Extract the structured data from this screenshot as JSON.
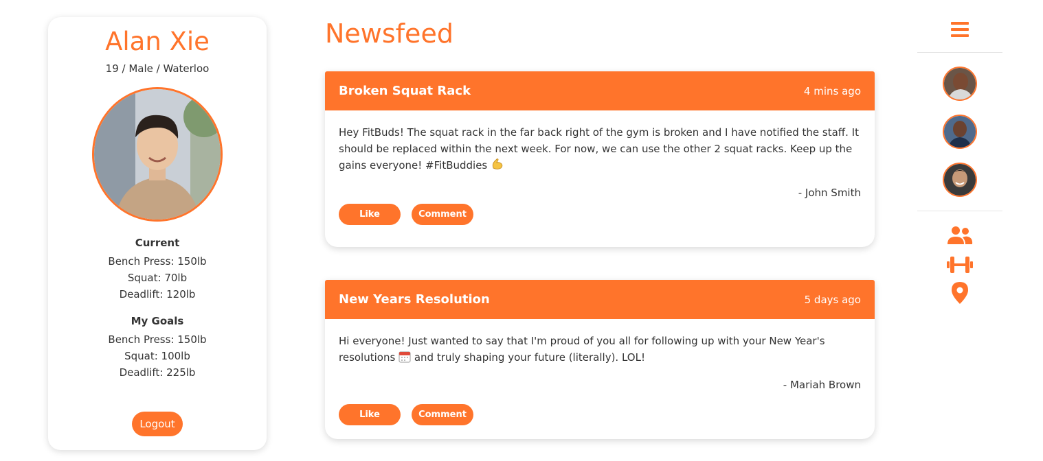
{
  "profile": {
    "name": "Alan Xie",
    "meta": "19 / Male / Waterloo",
    "current_heading": "Current",
    "current": [
      "Bench Press: 150lb",
      "Squat: 70lb",
      "Deadlift: 120lb"
    ],
    "goals_heading": "My Goals",
    "goals": [
      "Bench Press: 150lb",
      "Squat: 100lb",
      "Deadlift: 225lb"
    ],
    "logout_label": "Logout"
  },
  "feed": {
    "title": "Newsfeed",
    "posts": [
      {
        "title": "Broken Squat Rack",
        "time": "4 mins ago",
        "body": "Hey FitBuds! The squat rack in the far back right of the gym is broken and I have notified the staff. It should be replaced within the next week. For now, we can use the other 2 squat racks. Keep up the gains everyone! #FitBuddies",
        "emoji": "flexed-biceps",
        "author": "- John Smith",
        "like_label": "Like",
        "comment_label": "Comment"
      },
      {
        "title": "New Years Resolution",
        "time": "5 days ago",
        "body_part1": "Hi everyone! Just wanted to say that I'm proud of you all for following up with your New Year's resolutions",
        "emoji": "calendar",
        "body_part2": "and truly shaping your future (literally). LOL!",
        "author": "- Mariah Brown",
        "like_label": "Like",
        "comment_label": "Comment"
      }
    ]
  },
  "sidebar": {
    "menu_icon": "hamburger-menu-icon",
    "friends": [
      "friend-avatar",
      "friend-avatar",
      "friend-avatar"
    ],
    "nav_icons": [
      "users-icon",
      "dumbbell-icon",
      "location-pin-icon"
    ]
  },
  "colors": {
    "accent": "#ff742b",
    "text": "#333333"
  }
}
